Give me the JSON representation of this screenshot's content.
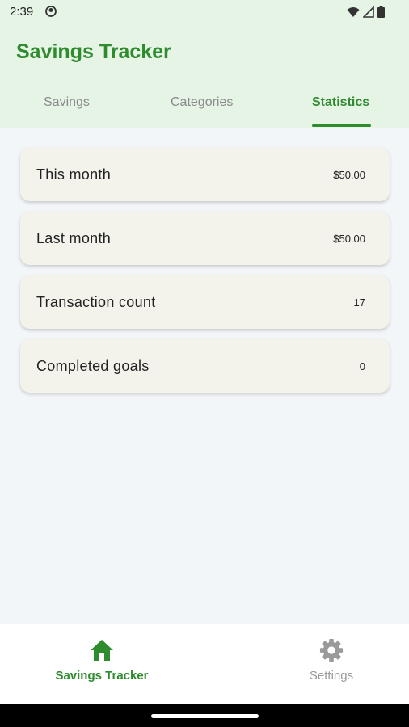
{
  "status_bar": {
    "time": "2:39"
  },
  "app": {
    "title": "Savings Tracker",
    "accent_color": "#2e8b2e",
    "tabs": [
      {
        "label": "Savings",
        "active": false
      },
      {
        "label": "Categories",
        "active": false
      },
      {
        "label": "Statistics",
        "active": true
      }
    ]
  },
  "stats": [
    {
      "label": "This month",
      "value": "$50.00"
    },
    {
      "label": "Last month",
      "value": "$50.00"
    },
    {
      "label": "Transaction count",
      "value": "17"
    },
    {
      "label": "Completed goals",
      "value": "0"
    }
  ],
  "bottom_nav": {
    "items": [
      {
        "label": "Savings Tracker",
        "icon": "home-icon",
        "active": true
      },
      {
        "label": "Settings",
        "icon": "gear-icon",
        "active": false
      }
    ]
  }
}
